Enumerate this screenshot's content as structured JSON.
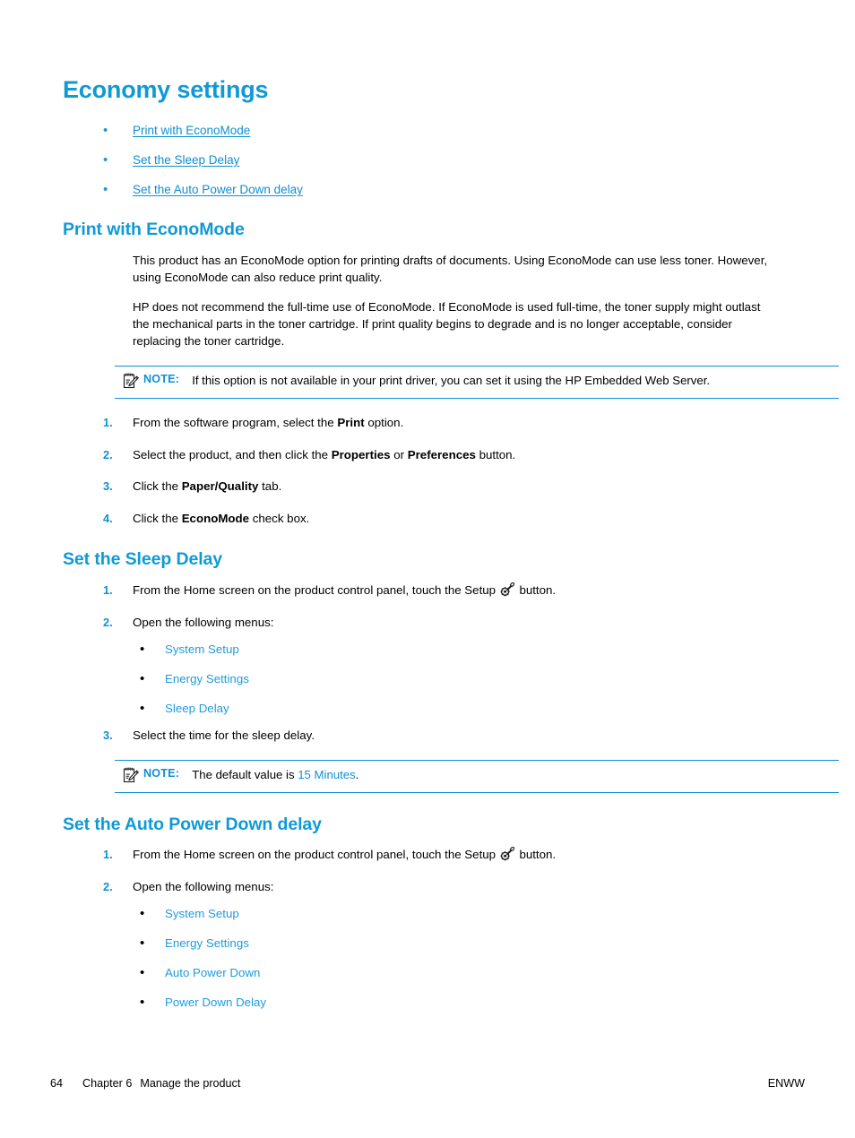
{
  "document": {
    "title": "Economy settings",
    "accent_blue": "#0f9ad7",
    "link_blue": "#0f8fd4"
  },
  "toc": {
    "items": [
      {
        "label": "Print with EconoMode"
      },
      {
        "label": "Set the Sleep Delay"
      },
      {
        "label": "Set the Auto Power Down delay"
      }
    ]
  },
  "sections": [
    {
      "heading": "Print with EconoMode",
      "paragraphs": [
        "This product has an EconoMode option for printing drafts of documents. Using EconoMode can use less toner. However, using EconoMode can also reduce print quality.",
        "HP does not recommend the full-time use of EconoMode. If EconoMode is used full-time, the toner supply might outlast the mechanical parts in the toner cartridge. If print quality begins to degrade and is no longer acceptable, consider replacing the toner cartridge."
      ],
      "note": {
        "label": "NOTE:",
        "text": "If this option is not available in your print driver, you can set it using the HP Embedded Web Server.",
        "icon": "note-pad-pencil-icon"
      },
      "steps": [
        {
          "pre": "From the software program, select the ",
          "bold": "Print",
          "post": " option."
        },
        {
          "pre": "Select the product, and then click the ",
          "bold": "Properties",
          "mid": " or ",
          "bold2": "Preferences",
          "post": " button."
        },
        {
          "pre": "Click the ",
          "bold": "Paper/Quality",
          "post": " tab."
        },
        {
          "pre": "Click the ",
          "bold": "EconoMode",
          "post": " check box."
        }
      ]
    },
    {
      "heading": "Set the Sleep Delay",
      "step1": {
        "pre": "From the Home screen on the product control panel, touch the Setup ",
        "icon": "setup-wrench-icon",
        "post": " button."
      },
      "step2": "Open the following menus:",
      "menus": [
        "System Setup",
        "Energy Settings",
        "Sleep Delay"
      ],
      "step3": "Select the time for the sleep delay.",
      "note": {
        "label": "NOTE:",
        "text_pre": "The default value is ",
        "text_highlight": "15 Minutes",
        "text_post": ".",
        "icon": "note-pad-pencil-icon"
      }
    },
    {
      "heading": "Set the Auto Power Down delay",
      "step1": {
        "pre": "From the Home screen on the product control panel, touch the Setup ",
        "icon": "setup-wrench-icon",
        "post": " button."
      },
      "step2": "Open the following menus:",
      "menus": [
        "System Setup",
        "Energy Settings",
        "Auto Power Down",
        "Power Down Delay"
      ]
    }
  ],
  "footer": {
    "page_number": "64",
    "chapter": "Chapter 6",
    "chapter_title": "Manage the product",
    "locale": "ENWW"
  }
}
